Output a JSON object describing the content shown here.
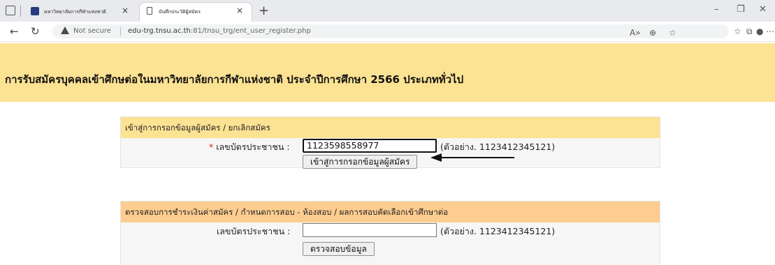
{
  "browser": {
    "tabs": [
      {
        "title": "มหาวิทยาลัยการกีฬาแห่งชาติ",
        "active": false
      },
      {
        "title": "บันทึกประวัติผู้สมัคร",
        "active": true
      }
    ],
    "new_tab_label": "+",
    "close_glyph": "×",
    "window_controls": {
      "minimize": "–",
      "restore": "❐",
      "close": "✕"
    },
    "security_label": "Not secure",
    "url_host": "edu-trg.tnsu.ac.th",
    "url_path": ":81/tnsu_trg/ent_user_register.php",
    "icons": [
      "back-icon",
      "refresh-icon",
      "warning-icon",
      "read-aloud-icon",
      "zoom-icon",
      "favorite-add-icon",
      "favorites-icon",
      "collections-icon",
      "profile-icon",
      "more-icon"
    ]
  },
  "page": {
    "banner_title": "การรับสมัครบุคคลเข้าศึกษต่อในมหาวิทยาลัยการกีฬาแห่งชาติ ประจำปีการศึกษา 2566    ประเภททั่วไป",
    "banner_color": "#fce293",
    "register_section": {
      "heading": "เข้าสู่การกรอกข้อมูลผู้สมัคร / ยกเลิกสมัคร",
      "heading_color": "#fce293",
      "required_mark": "*",
      "id_label": "เลขบัตรประชาชน :",
      "id_value": "1123598558977",
      "example": "(ตัวอย่าง. 1123412345121)",
      "submit_label": "เข้าสู่การกรอกข้อมูลผู้สมัคร"
    },
    "check_section": {
      "heading": "ตรวจสอบการชำระเงินค่าสมัคร / กำหนดการสอบ - ห้องสอบ / ผลการสอบคัดเลือกเข้าศึกษาต่อ",
      "heading_color": "#fdcd8f",
      "id_label": "เลขบัตรประชาชน :",
      "id_value": "",
      "example": "(ตัวอย่าง. 1123412345121)",
      "submit_label": "ตรวจสอบข้อมูล"
    }
  }
}
